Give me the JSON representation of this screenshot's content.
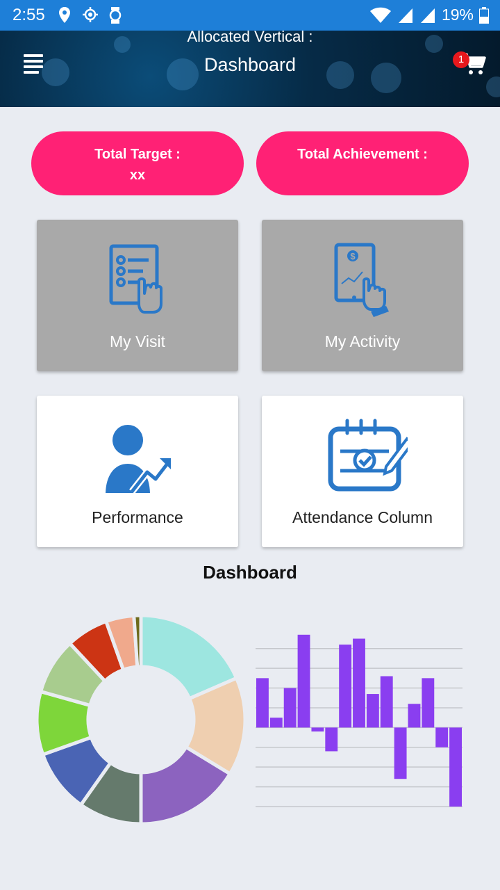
{
  "status_bar": {
    "time": "2:55",
    "battery": "19%",
    "icons": [
      "location-icon",
      "gps-icon",
      "watch-icon",
      "wifi-icon",
      "signal-icon",
      "signal-icon",
      "battery-icon"
    ]
  },
  "header": {
    "subtitle": "Allocated Vertical :",
    "title": "Dashboard",
    "cart_count": "1",
    "menu_icon": "menu-icon",
    "cart_icon": "cart-icon"
  },
  "summary": {
    "total_target_label": "Total Target :",
    "total_target_value": "xx",
    "total_achievement_label": "Total Achievement :"
  },
  "tiles": [
    {
      "label": "My Visit",
      "icon": "checklist-hand-icon"
    },
    {
      "label": "My Activity",
      "icon": "tablet-chart-hand-icon"
    },
    {
      "label": "Performance",
      "icon": "person-growth-icon"
    },
    {
      "label": "Attendance Column",
      "icon": "calendar-check-icon"
    }
  ],
  "dashboard_title": "Dashboard",
  "colors": {
    "status_bar": "#1e7fd8",
    "pill": "#ff2175",
    "tile_gray": "#a9a9a9",
    "icon_blue": "#2a78c8",
    "bar": "#8a3ef0"
  },
  "chart_data": [
    {
      "type": "pie",
      "subtype": "donut",
      "values": [
        17,
        14,
        15,
        9,
        9,
        9,
        8,
        6,
        4,
        1
      ],
      "colors": [
        "#9de6e0",
        "#efcfb0",
        "#8c63bf",
        "#657a6c",
        "#4a64b4",
        "#7ed63a",
        "#a8cc8e",
        "#cc3414",
        "#f0a98c",
        "#6d6a1c"
      ]
    },
    {
      "type": "bar",
      "values": [
        2.5,
        0.5,
        2.0,
        4.7,
        -0.2,
        -1.2,
        4.2,
        4.5,
        1.7,
        2.6,
        -2.6,
        1.2,
        2.5,
        -1.0,
        -4.0
      ],
      "ylim": [
        -4,
        4.8
      ],
      "gridlines": [
        4,
        3,
        2,
        1,
        0,
        -1,
        -2,
        -3,
        -4
      ],
      "grid": true
    }
  ]
}
